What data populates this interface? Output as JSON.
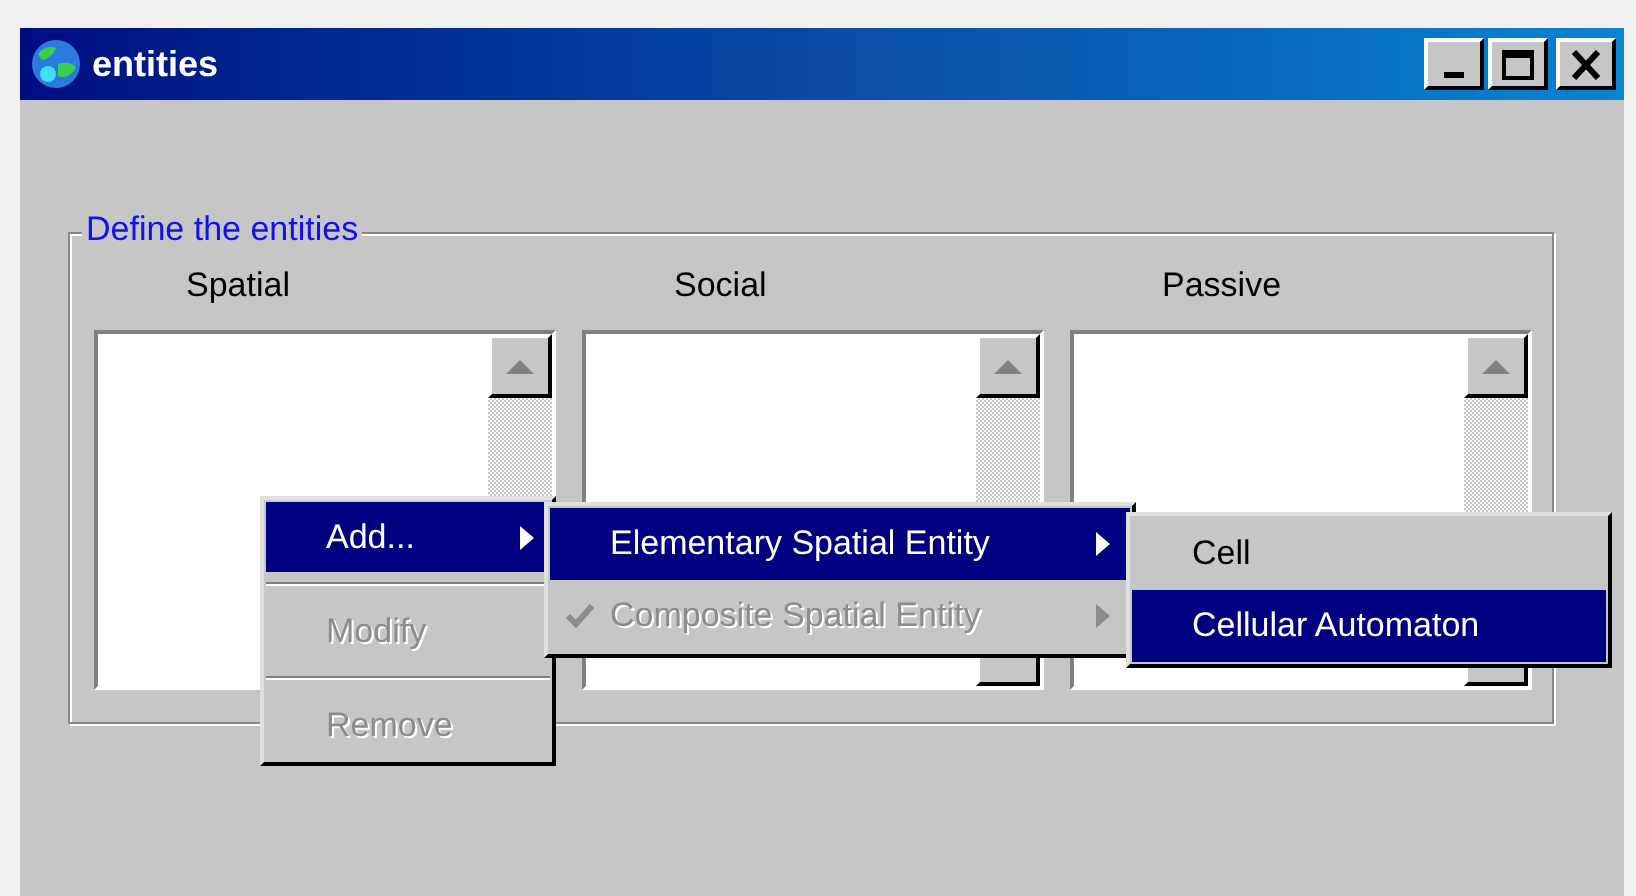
{
  "window": {
    "title": "entities"
  },
  "group": {
    "label": "Define the entities"
  },
  "lists": [
    {
      "header": "Spatial"
    },
    {
      "header": "Social"
    },
    {
      "header": "Passive"
    }
  ],
  "menus": [
    {
      "items": [
        {
          "kind": "item",
          "label": "Add...",
          "selected": true,
          "disabled": false,
          "submenu": true
        },
        {
          "kind": "separator"
        },
        {
          "kind": "item",
          "label": "Modify",
          "selected": false,
          "disabled": true,
          "submenu": false
        },
        {
          "kind": "separator"
        },
        {
          "kind": "item",
          "label": "Remove",
          "selected": false,
          "disabled": true,
          "submenu": false
        }
      ]
    },
    {
      "items": [
        {
          "kind": "item",
          "label": "Elementary Spatial Entity",
          "selected": true,
          "disabled": false,
          "checked": false,
          "submenu": true
        },
        {
          "kind": "item",
          "label": "Composite Spatial Entity",
          "selected": false,
          "disabled": true,
          "checked": true,
          "submenu": true
        }
      ]
    },
    {
      "items": [
        {
          "kind": "item",
          "label": "Cell",
          "selected": false,
          "disabled": false,
          "submenu": false
        },
        {
          "kind": "item",
          "label": "Cellular Automaton",
          "selected": true,
          "disabled": false,
          "submenu": false
        }
      ]
    }
  ]
}
